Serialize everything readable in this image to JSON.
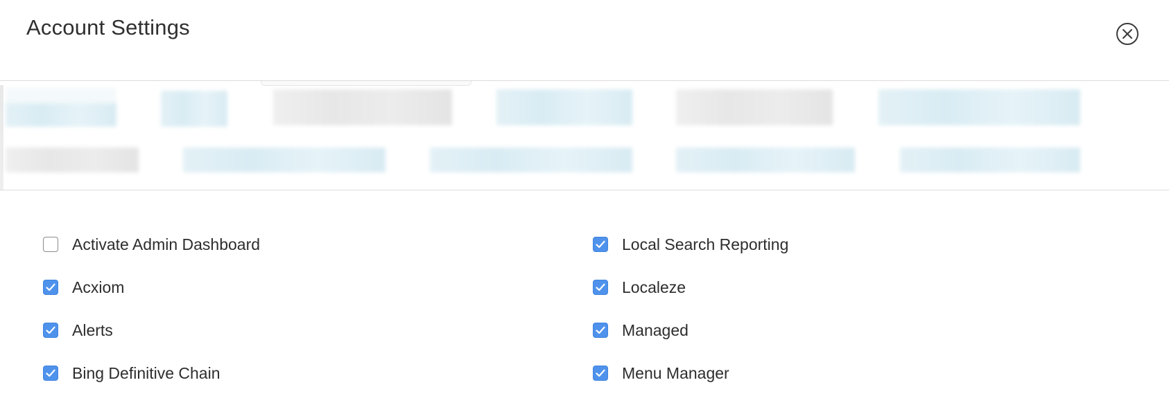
{
  "modal": {
    "title": "Account Settings",
    "close_icon": "close-circle-icon"
  },
  "redacted": {
    "note": ""
  },
  "settings": {
    "left_column": [
      {
        "label": "Activate Admin Dashboard",
        "checked": false
      },
      {
        "label": "Acxiom",
        "checked": true
      },
      {
        "label": "Alerts",
        "checked": true
      },
      {
        "label": "Bing Definitive Chain",
        "checked": true
      }
    ],
    "right_column": [
      {
        "label": "Local Search Reporting",
        "checked": true
      },
      {
        "label": "Localeze",
        "checked": true
      },
      {
        "label": "Managed",
        "checked": true
      },
      {
        "label": "Menu Manager",
        "checked": true
      }
    ],
    "colors": {
      "checkbox_checked": "#4f92ec",
      "checkbox_unchecked_border": "#8a8a8a"
    }
  }
}
